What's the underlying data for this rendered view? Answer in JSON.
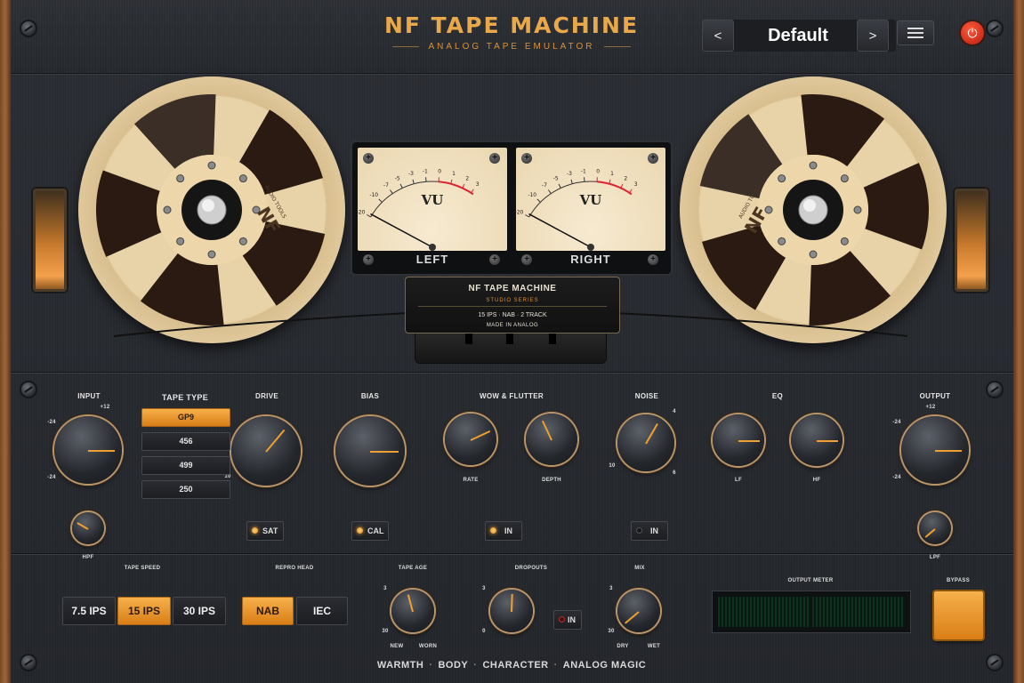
{
  "brand": {
    "title": "NF TAPE MACHINE",
    "subtitle": "ANALOG TAPE EMULATOR"
  },
  "preset": {
    "prev": "<",
    "name": "Default",
    "next": ">"
  },
  "vu": {
    "left_label": "LEFT",
    "right_label": "RIGHT",
    "face": "VU",
    "scale": [
      "-20",
      "-10",
      "-7",
      "-5",
      "-3",
      "-1",
      "0",
      "1",
      "2",
      "3"
    ]
  },
  "reel": {
    "logo": "NF",
    "maker": "AUDIO TOOLS"
  },
  "plate": {
    "title": "NF TAPE MACHINE",
    "series": "STUDIO SERIES",
    "spec": "15 IPS · NAB · 2 TRACK",
    "origin": "MADE IN ANALOG"
  },
  "controls": {
    "input": {
      "label": "INPUT",
      "min": "-24",
      "max": "-24",
      "top": "+12"
    },
    "hpf": {
      "label": "HPF"
    },
    "tape_type": {
      "label": "TAPE TYPE",
      "options": [
        "GP9",
        "456",
        "499",
        "250"
      ],
      "selected": "GP9"
    },
    "drive": {
      "label": "DRIVE",
      "min": "10"
    },
    "sat": {
      "label": "SAT",
      "state": "on"
    },
    "bias": {
      "label": "BIAS"
    },
    "cal": {
      "label": "CAL",
      "state": "on"
    },
    "wow": {
      "label": "WOW & FLUTTER",
      "rate": "RATE",
      "depth": "DEPTH",
      "in": "IN"
    },
    "noise": {
      "label": "NOISE",
      "in": "IN",
      "tick_low": "10",
      "tick_high": "4",
      "tick_right": "6"
    },
    "eq": {
      "label": "EQ",
      "lf": "LF",
      "hf": "HF"
    },
    "output": {
      "label": "OUTPUT",
      "min": "-24",
      "max": "-24",
      "top": "+12"
    },
    "lpf": {
      "label": "LPF"
    }
  },
  "bottom": {
    "tape_speed": {
      "label": "TAPE SPEED",
      "options": [
        "7.5 IPS",
        "15 IPS",
        "30 IPS"
      ],
      "selected": "15 IPS"
    },
    "repro_head": {
      "label": "REPRO HEAD",
      "options": [
        "NAB",
        "IEC"
      ],
      "selected": "NAB"
    },
    "tape_age": {
      "label": "TAPE AGE",
      "left": "NEW",
      "right": "WORN",
      "tick_top": "3",
      "tick_low": "30"
    },
    "dropouts": {
      "label": "DROPOUTS",
      "in": "IN",
      "tick_top": "3",
      "tick_low": "0"
    },
    "mix": {
      "label": "MIX",
      "left": "DRY",
      "right": "WET",
      "tick_top": "3",
      "tick_low": "30"
    },
    "output_meter": {
      "label": "OUTPUT METER"
    },
    "bypass": {
      "label": "BYPASS"
    }
  },
  "footer": [
    "WARMTH",
    "BODY",
    "CHARACTER",
    "ANALOG MAGIC"
  ],
  "colors": {
    "accent": "#e9a94a",
    "panel": "#26292e",
    "reel": "#e8d3a9"
  }
}
